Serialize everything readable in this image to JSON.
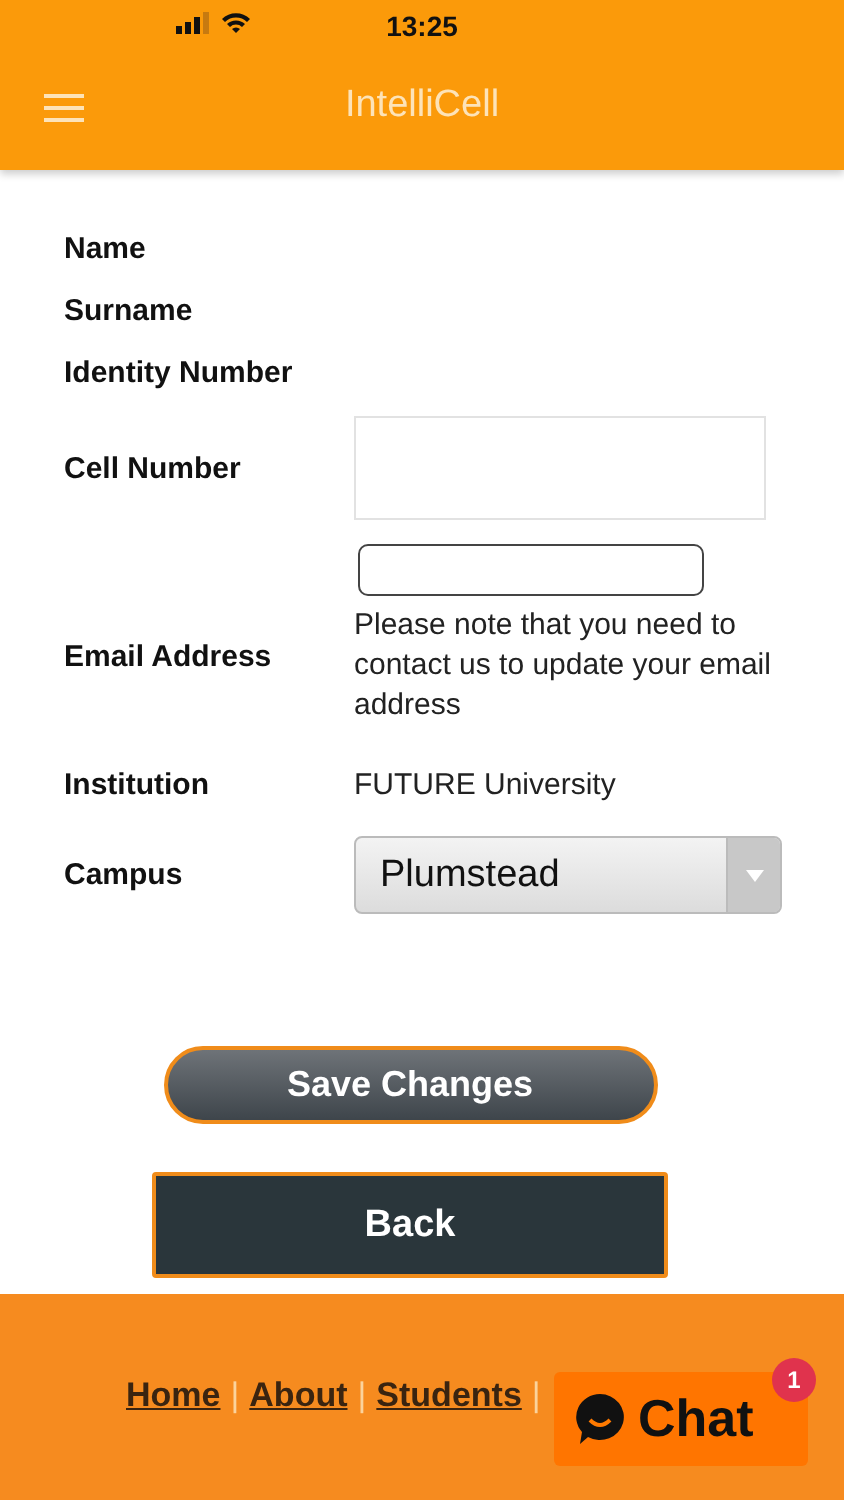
{
  "status_bar": {
    "time": "13:25"
  },
  "header": {
    "title": "IntelliCell"
  },
  "fields": [
    {
      "kind": "text",
      "label": "Name"
    },
    {
      "kind": "text",
      "label": "Surname"
    },
    {
      "kind": "text",
      "label": "Identity Number"
    },
    {
      "kind": "input",
      "label": "Cell Number"
    },
    {
      "kind": "email",
      "label": "Email Address",
      "note": "Please note that you need to contact us to update your email address"
    },
    {
      "kind": "text",
      "label": "Institution",
      "value": "FUTURE University"
    },
    {
      "kind": "select",
      "label": "Campus",
      "value": "Plumstead"
    }
  ],
  "save_button": "Save Changes",
  "back_button": "Back",
  "footer": {
    "links": [
      "Home",
      "About",
      "Students"
    ],
    "separator": "|"
  },
  "chat": {
    "label": "Chat",
    "badge": "1"
  }
}
